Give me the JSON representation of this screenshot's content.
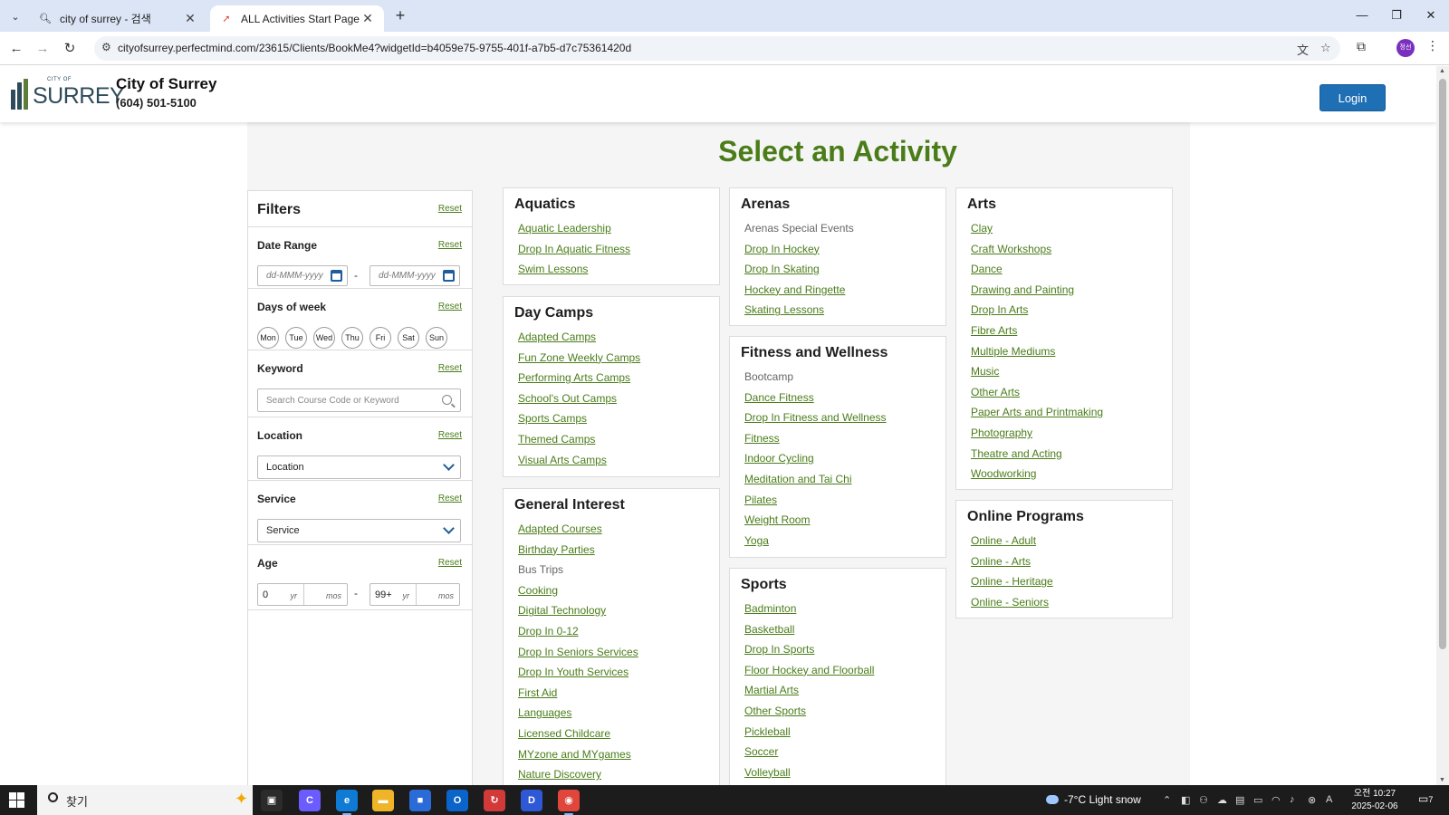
{
  "browser": {
    "tabs": [
      {
        "title": "city of surrey - 검색",
        "active": false,
        "icon": "search-icon"
      },
      {
        "title": "ALL Activities Start Page",
        "active": true,
        "icon": "rocket-icon"
      }
    ],
    "url": "cityofsurrey.perfectmind.com/23615/Clients/BookMe4?widgetId=b4059e75-9755-401f-a7b5-d7c75361420d",
    "profile_initials": "정선"
  },
  "header": {
    "logo_small": "CITY OF",
    "logo_text": "SURREY",
    "org_name": "City of Surrey",
    "phone": "(604) 501-5100",
    "login_label": "Login"
  },
  "page": {
    "title": "Select an Activity"
  },
  "filters": {
    "title": "Filters",
    "reset_label": "Reset",
    "date_range": {
      "label": "Date Range",
      "from_placeholder": "dd-MMM-yyyy",
      "to_placeholder": "dd-MMM-yyyy",
      "separator": "-"
    },
    "days": {
      "label": "Days of week",
      "items": [
        "Mon",
        "Tue",
        "Wed",
        "Thu",
        "Fri",
        "Sat",
        "Sun"
      ]
    },
    "keyword": {
      "label": "Keyword",
      "placeholder": "Search Course Code or Keyword"
    },
    "location": {
      "label": "Location",
      "value": "Location"
    },
    "service": {
      "label": "Service",
      "value": "Service"
    },
    "age": {
      "label": "Age",
      "min_yr": "0",
      "max_yr": "99+",
      "yr_unit": "yr",
      "mos_unit": "mos",
      "separator": "-"
    }
  },
  "categories": [
    {
      "title": "Aquatics",
      "items": [
        {
          "label": "Aquatic Leadership",
          "link": true
        },
        {
          "label": "Drop In Aquatic Fitness",
          "link": true
        },
        {
          "label": "Swim Lessons",
          "link": true
        }
      ]
    },
    {
      "title": "Day Camps",
      "items": [
        {
          "label": "Adapted Camps",
          "link": true
        },
        {
          "label": "Fun Zone Weekly Camps",
          "link": true
        },
        {
          "label": "Performing Arts Camps",
          "link": true
        },
        {
          "label": "School's Out Camps",
          "link": true
        },
        {
          "label": "Sports Camps",
          "link": true
        },
        {
          "label": "Themed Camps",
          "link": true
        },
        {
          "label": "Visual Arts Camps",
          "link": true
        }
      ]
    },
    {
      "title": "General Interest",
      "items": [
        {
          "label": "Adapted Courses",
          "link": true
        },
        {
          "label": "Birthday Parties",
          "link": true
        },
        {
          "label": "Bus Trips",
          "link": false
        },
        {
          "label": "Cooking",
          "link": true
        },
        {
          "label": "Digital Technology",
          "link": true
        },
        {
          "label": "Drop In 0-12",
          "link": true
        },
        {
          "label": "Drop In Seniors Services",
          "link": true
        },
        {
          "label": "Drop In Youth Services",
          "link": true
        },
        {
          "label": "First Aid",
          "link": true
        },
        {
          "label": "Languages",
          "link": true
        },
        {
          "label": "Licensed Childcare",
          "link": true
        },
        {
          "label": "MYzone and MYgames",
          "link": true
        },
        {
          "label": "Nature Discovery",
          "link": true
        }
      ]
    },
    {
      "title": "Arenas",
      "items": [
        {
          "label": "Arenas Special Events",
          "link": false
        },
        {
          "label": "Drop In Hockey",
          "link": true
        },
        {
          "label": "Drop In Skating",
          "link": true
        },
        {
          "label": "Hockey and Ringette",
          "link": true
        },
        {
          "label": "Skating Lessons",
          "link": true
        }
      ]
    },
    {
      "title": "Fitness and Wellness",
      "items": [
        {
          "label": "Bootcamp",
          "link": false
        },
        {
          "label": "Dance Fitness",
          "link": true
        },
        {
          "label": "Drop In Fitness and Wellness",
          "link": true
        },
        {
          "label": "Fitness",
          "link": true
        },
        {
          "label": "Indoor Cycling",
          "link": true
        },
        {
          "label": "Meditation and Tai Chi",
          "link": true
        },
        {
          "label": "Pilates",
          "link": true
        },
        {
          "label": "Weight Room",
          "link": true
        },
        {
          "label": "Yoga",
          "link": true
        }
      ]
    },
    {
      "title": "Sports",
      "items": [
        {
          "label": "Badminton",
          "link": true
        },
        {
          "label": "Basketball",
          "link": true
        },
        {
          "label": "Drop In Sports",
          "link": true
        },
        {
          "label": "Floor Hockey and Floorball",
          "link": true
        },
        {
          "label": "Martial Arts",
          "link": true
        },
        {
          "label": "Other Sports",
          "link": true
        },
        {
          "label": "Pickleball",
          "link": true
        },
        {
          "label": "Soccer",
          "link": true
        },
        {
          "label": "Volleyball",
          "link": true
        }
      ]
    },
    {
      "title": "Arts",
      "items": [
        {
          "label": "Clay",
          "link": true
        },
        {
          "label": "Craft Workshops",
          "link": true
        },
        {
          "label": "Dance",
          "link": true
        },
        {
          "label": "Drawing and Painting",
          "link": true
        },
        {
          "label": "Drop In Arts",
          "link": true
        },
        {
          "label": "Fibre Arts",
          "link": true
        },
        {
          "label": "Multiple Mediums",
          "link": true
        },
        {
          "label": "Music",
          "link": true
        },
        {
          "label": "Other Arts",
          "link": true
        },
        {
          "label": "Paper Arts and Printmaking",
          "link": true
        },
        {
          "label": "Photography",
          "link": true
        },
        {
          "label": "Theatre and Acting",
          "link": true
        },
        {
          "label": "Woodworking",
          "link": true
        }
      ]
    },
    {
      "title": "Online Programs",
      "items": [
        {
          "label": "Online - Adult",
          "link": true
        },
        {
          "label": "Online - Arts",
          "link": true
        },
        {
          "label": "Online - Heritage",
          "link": true
        },
        {
          "label": "Online - Seniors",
          "link": true
        }
      ]
    }
  ],
  "taskbar": {
    "search_text": "찾기",
    "weather": "-7°C  Light snow",
    "time": "오전 10:27",
    "date": "2025-02-06",
    "notification_count": "7",
    "apps": [
      {
        "name": "task-view",
        "color": "#2b2b2b",
        "glyph": "▣"
      },
      {
        "name": "copilot",
        "color": "#6a5cff",
        "glyph": "C"
      },
      {
        "name": "edge",
        "color": "#0f7bd5",
        "glyph": "e"
      },
      {
        "name": "file-explorer",
        "color": "#f0b429",
        "glyph": "▬"
      },
      {
        "name": "ms-store",
        "color": "#2a6bd8",
        "glyph": "■"
      },
      {
        "name": "outlook",
        "color": "#0a64c9",
        "glyph": "O"
      },
      {
        "name": "app-red",
        "color": "#d23a3a",
        "glyph": "↻"
      },
      {
        "name": "app-d",
        "color": "#2f58d6",
        "glyph": "D"
      },
      {
        "name": "chrome",
        "color": "#e0463b",
        "glyph": "◉"
      }
    ]
  }
}
